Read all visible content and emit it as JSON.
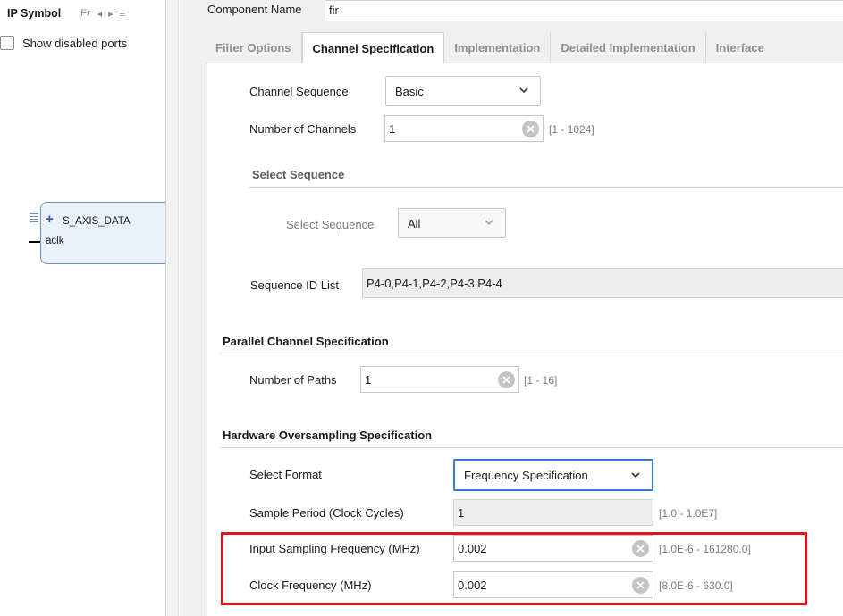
{
  "left_panel": {
    "tab_ip_symbol": "IP Symbol",
    "tab_fr": "Fr",
    "tab_nav": "◂ ▸ ≡",
    "show_disabled_label": "Show disabled ports",
    "ip_block": {
      "port_data": "S_AXIS_DATA",
      "port_clk": "aclk"
    }
  },
  "header": {
    "component_name_label": "Component Name",
    "component_name_value": "fir"
  },
  "tabs": [
    {
      "label": "Filter Options",
      "active": false
    },
    {
      "label": "Channel Specification",
      "active": true
    },
    {
      "label": "Implementation",
      "active": false
    },
    {
      "label": "Detailed Implementation",
      "active": false
    },
    {
      "label": "Interface",
      "active": false
    }
  ],
  "channel": {
    "sequence_label": "Channel Sequence",
    "sequence_value": "Basic",
    "num_channels_label": "Number of Channels",
    "num_channels_value": "1",
    "num_channels_range": "[1 - 1024]",
    "select_sequence_heading": "Select Sequence",
    "select_sequence_label": "Select Sequence",
    "select_sequence_value": "All",
    "sequence_id_label": "Sequence ID List",
    "sequence_id_value": "P4-0,P4-1,P4-2,P4-3,P4-4"
  },
  "parallel": {
    "heading": "Parallel Channel Specification",
    "num_paths_label": "Number of Paths",
    "num_paths_value": "1",
    "num_paths_range": "[1 - 16]"
  },
  "oversampling": {
    "heading": "Hardware Oversampling Specification",
    "format_label": "Select Format",
    "format_value": "Frequency Specification",
    "sample_period_label": "Sample Period (Clock Cycles)",
    "sample_period_value": "1",
    "sample_period_range": "[1.0 - 1.0E7]",
    "input_freq_label": "Input Sampling Frequency (MHz)",
    "input_freq_value": "0.002",
    "input_freq_range": "[1.0E-6 - 161280.0]",
    "clock_freq_label": "Clock Frequency (MHz)",
    "clock_freq_value": "0.002",
    "clock_freq_range": "[8.0E-6 - 630.0]"
  },
  "colors": {
    "highlight": "#e0141b",
    "focus_border": "#3a78d8",
    "panel_bg": "#f0f0f0"
  }
}
